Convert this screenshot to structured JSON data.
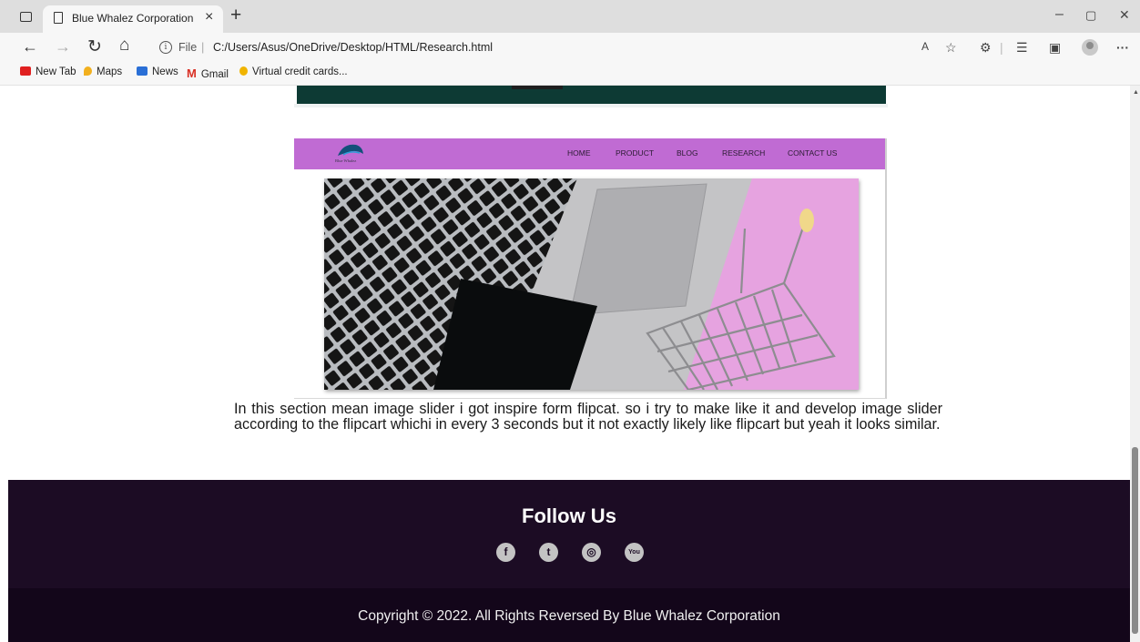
{
  "browser": {
    "tab_title": "Blue Whalez Corporation",
    "tab_close": "×",
    "new_tab": "+",
    "scheme": "File",
    "separator": "|",
    "url": "C:/Users/Asus/OneDrive/Desktop/HTML/Research.html",
    "nav": {
      "back": "←",
      "forward": "→",
      "refresh": "↻",
      "home": "⌂"
    },
    "window": {
      "minimize": "–",
      "maximize": "▢",
      "close": "✕"
    },
    "tools": {
      "read_aloud": "A",
      "favorite": "☆",
      "extensions": "⚙",
      "favorites": "☰",
      "collections": "▣",
      "more": "···"
    },
    "bookmarks": [
      "New Tab",
      "Maps",
      "News",
      "Gmail",
      "Virtual credit cards..."
    ],
    "bookmark_colors": [
      "#e02020",
      "#f2b01e",
      "#2a6fd6",
      "#d93025",
      "#f0b400"
    ]
  },
  "site_screenshot": {
    "logo_text": "Blue Whalez",
    "nav": [
      "HOME",
      "PRODUCT",
      "BLOG",
      "RESEARCH",
      "CONTACT US"
    ],
    "nav_color": "#c06bd3"
  },
  "description": "In this section mean image slider i got inspire form flipcat. so i try to make like it and develop image slider according to the flipcart whichi in every 3 seconds but it not exactly likely like flipcart but yeah it looks similar.",
  "footer": {
    "follow_title": "Follow Us",
    "socials": [
      {
        "icon": "facebook-icon",
        "glyph": "f"
      },
      {
        "icon": "twitter-icon",
        "glyph": "t"
      },
      {
        "icon": "instagram-icon",
        "glyph": "◎"
      },
      {
        "icon": "youtube-icon",
        "glyph": "You"
      }
    ],
    "copyright": "Copyright © 2022. All Rights Reversed By Blue Whalez Corporation",
    "bg_color": "#1c0c24"
  }
}
